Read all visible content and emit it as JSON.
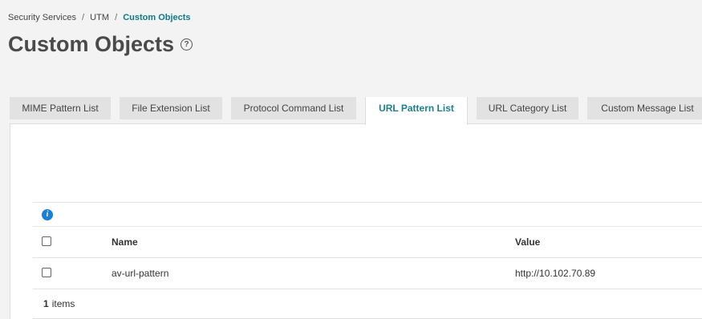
{
  "breadcrumb": {
    "items": [
      "Security Services",
      "UTM",
      "Custom Objects"
    ],
    "separator": "/"
  },
  "page": {
    "title": "Custom Objects",
    "help_glyph": "?"
  },
  "tabs": [
    {
      "label": "MIME Pattern List",
      "active": false
    },
    {
      "label": "File Extension List",
      "active": false
    },
    {
      "label": "Protocol Command List",
      "active": false
    },
    {
      "label": "URL Pattern List",
      "active": true
    },
    {
      "label": "URL Category List",
      "active": false
    },
    {
      "label": "Custom Message List",
      "active": false
    }
  ],
  "grid": {
    "info_glyph": "i",
    "columns": {
      "name": "Name",
      "value": "Value"
    },
    "rows": [
      {
        "name": "av-url-pattern",
        "value": "http://10.102.70.89"
      }
    ],
    "footer": {
      "count": "1",
      "label": "items"
    }
  },
  "colors": {
    "accent": "#0e7a86",
    "info": "#1a7fd6",
    "tab_inactive": "#e2e2e2",
    "background": "#f3f3f3"
  }
}
